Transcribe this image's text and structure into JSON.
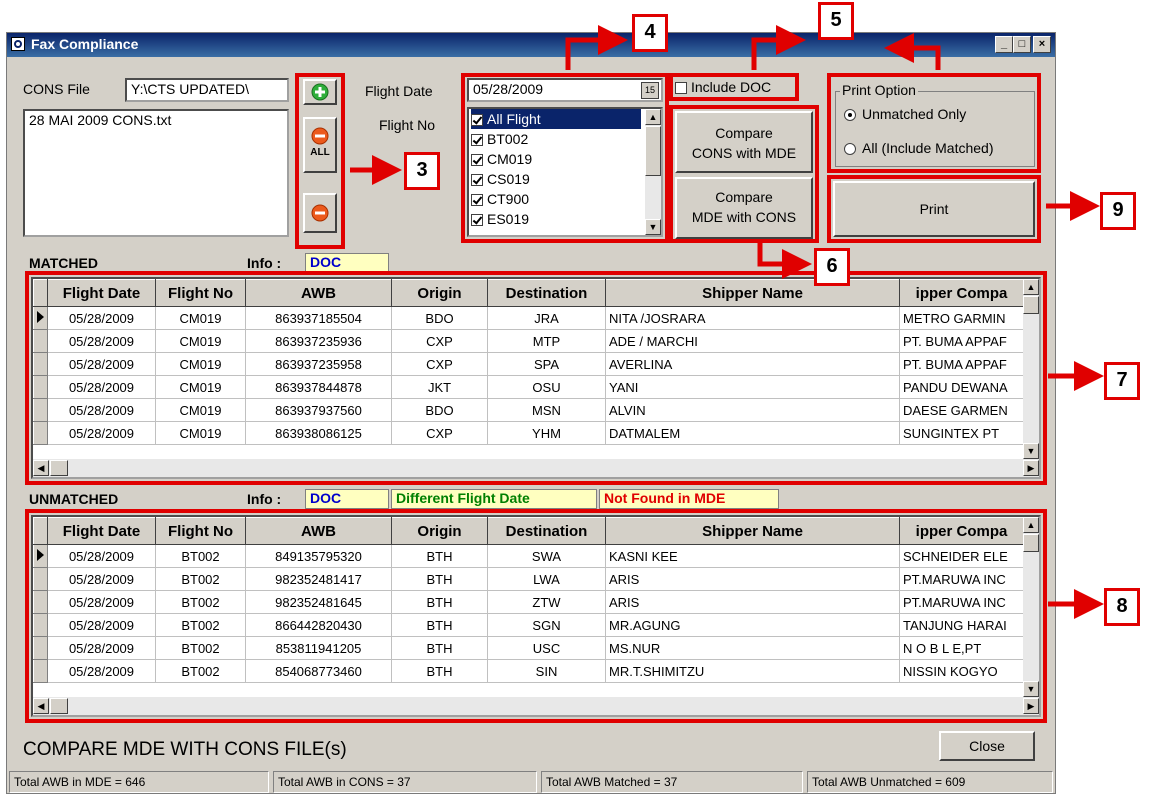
{
  "window": {
    "title": "Fax Compliance",
    "minimize": "_",
    "maximize": "□",
    "close": "×"
  },
  "cons": {
    "label": "CONS File",
    "path": "Y:\\CTS UPDATED\\",
    "files": [
      "28 MAI 2009 CONS.txt"
    ],
    "remove_all_label": "ALL"
  },
  "flight": {
    "date_label": "Flight Date",
    "date_value": "05/28/2009",
    "calendar_label": "15",
    "no_label": "Flight No",
    "items": [
      {
        "label": "All Flight",
        "checked": true,
        "selected": true
      },
      {
        "label": "BT002",
        "checked": true
      },
      {
        "label": "CM019",
        "checked": true
      },
      {
        "label": "CS019",
        "checked": true
      },
      {
        "label": "CT900",
        "checked": true
      },
      {
        "label": "ES019",
        "checked": true
      }
    ]
  },
  "include_doc": {
    "label": "Include DOC",
    "checked": false
  },
  "compare": {
    "cons_mde_line1": "Compare",
    "cons_mde_line2": "CONS with MDE",
    "mde_cons_line1": "Compare",
    "mde_cons_line2": "MDE with CONS"
  },
  "print_option": {
    "legend": "Print Option",
    "unmatched_only": "Unmatched Only",
    "all_matched": "All (Include Matched)",
    "print_label": "Print"
  },
  "matched": {
    "title": "MATCHED",
    "info_label": "Info :",
    "doc_tag": "DOC",
    "columns": [
      "Flight Date",
      "Flight No",
      "AWB",
      "Origin",
      "Destination",
      "Shipper Name",
      "ipper Compa"
    ],
    "rows": [
      [
        "05/28/2009",
        "CM019",
        "863937185504",
        "BDO",
        "JRA",
        "NITA /JOSRARA",
        "METRO GARMIN"
      ],
      [
        "05/28/2009",
        "CM019",
        "863937235936",
        "CXP",
        "MTP",
        "ADE / MARCHI",
        "PT. BUMA APPAF"
      ],
      [
        "05/28/2009",
        "CM019",
        "863937235958",
        "CXP",
        "SPA",
        "AVERLINA",
        "PT. BUMA APPAF"
      ],
      [
        "05/28/2009",
        "CM019",
        "863937844878",
        "JKT",
        "OSU",
        "YANI",
        "PANDU DEWANA"
      ],
      [
        "05/28/2009",
        "CM019",
        "863937937560",
        "BDO",
        "MSN",
        "ALVIN",
        "DAESE GARMEN"
      ],
      [
        "05/28/2009",
        "CM019",
        "863938086125",
        "CXP",
        "YHM",
        "DATMALEM",
        "SUNGINTEX PT"
      ]
    ]
  },
  "unmatched": {
    "title": "UNMATCHED",
    "info_label": "Info :",
    "doc_tag": "DOC",
    "diff_date_tag": "Different Flight Date",
    "not_found_tag": "Not Found in MDE",
    "columns": [
      "Flight Date",
      "Flight No",
      "AWB",
      "Origin",
      "Destination",
      "Shipper Name",
      "ipper Compa"
    ],
    "rows": [
      [
        "05/28/2009",
        "BT002",
        "849135795320",
        "BTH",
        "SWA",
        "KASNI KEE",
        "SCHNEIDER ELE"
      ],
      [
        "05/28/2009",
        "BT002",
        "982352481417",
        "BTH",
        "LWA",
        "ARIS",
        "PT.MARUWA INC"
      ],
      [
        "05/28/2009",
        "BT002",
        "982352481645",
        "BTH",
        "ZTW",
        "ARIS",
        "PT.MARUWA INC"
      ],
      [
        "05/28/2009",
        "BT002",
        "866442820430",
        "BTH",
        "SGN",
        "MR.AGUNG",
        "TANJUNG HARAI"
      ],
      [
        "05/28/2009",
        "BT002",
        "853811941205",
        "BTH",
        "USC",
        "MS.NUR",
        "N O B L E,PT"
      ],
      [
        "05/28/2009",
        "BT002",
        "854068773460",
        "BTH",
        "SIN",
        "MR.T.SHIMITZU",
        "NISSIN KOGYO"
      ]
    ]
  },
  "footer": {
    "caption": "COMPARE MDE WITH CONS FILE(s)",
    "close_label": "Close"
  },
  "status": {
    "mde": "Total AWB in MDE = 646",
    "cons": "Total AWB in CONS = 37",
    "matched": "Total AWB Matched = 37",
    "unmatched": "Total AWB Unmatched = 609"
  },
  "callouts": {
    "c3": "3",
    "c4": "4",
    "c5": "5",
    "c6": "6",
    "c7": "7",
    "c8": "8",
    "c9": "9"
  },
  "colors": {
    "annotation": "#e00000",
    "doc_tag": "#0000cc",
    "diff_date_tag": "#008000",
    "not_found_tag": "#e00000",
    "info_bg": "#ffffc0"
  }
}
